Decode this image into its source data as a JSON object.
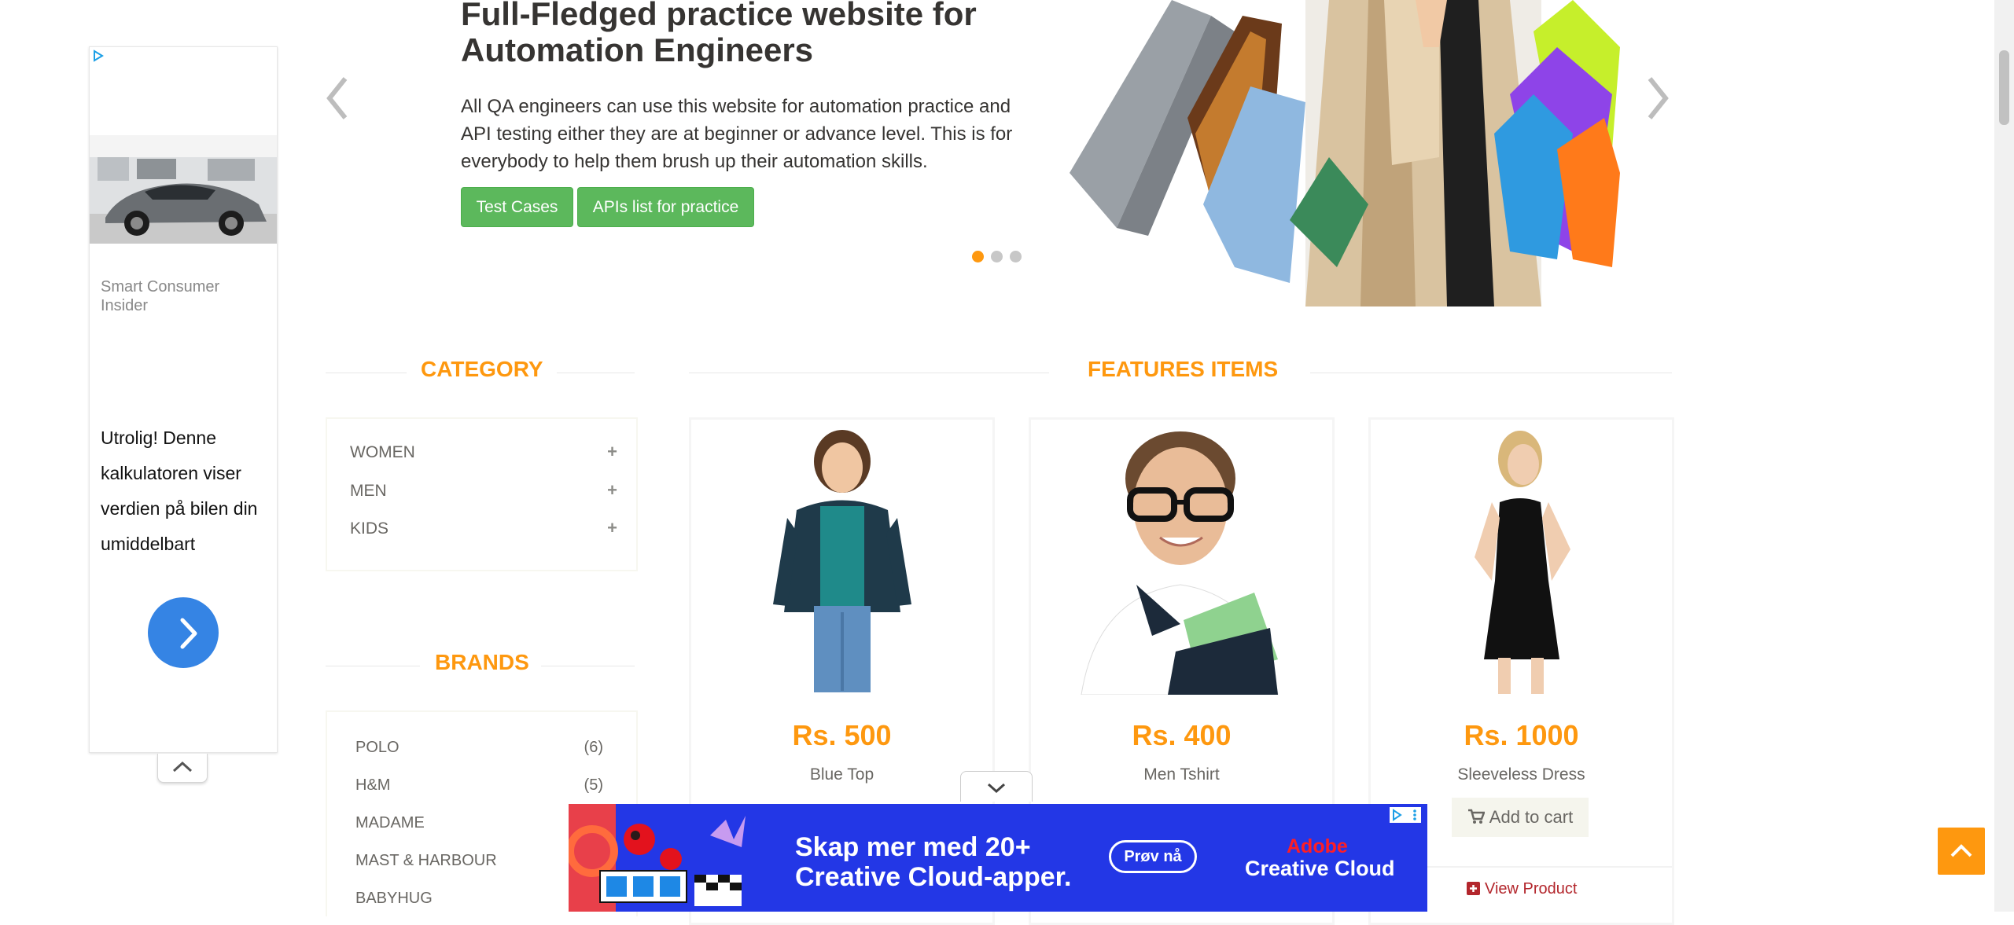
{
  "side_ad": {
    "advertiser": "Smart Consumer Insider",
    "headline": "Utrolig! Denne kalkulatoren viser verdien på bilen din umiddelbart",
    "icons": [
      "adchoices-icon",
      "car-image",
      "chevron-right-icon",
      "chevron-up-icon"
    ]
  },
  "slider": {
    "title": "Full-Fledged practice website for Automation Engineers",
    "text": "All QA engineers can use this website for automation practice and API testing either they are at beginner or advance level. This is for everybody to help them brush up their automation skills.",
    "btn_test_cases": "Test Cases",
    "btn_apis": "APIs list for practice",
    "active_dot": 1,
    "dot_count": 3
  },
  "category": {
    "title": "CATEGORY",
    "items": [
      {
        "label": "WOMEN"
      },
      {
        "label": "MEN"
      },
      {
        "label": "KIDS"
      }
    ]
  },
  "brands": {
    "title": "BRANDS",
    "items": [
      {
        "label": "POLO",
        "count": "(6)"
      },
      {
        "label": "H&M",
        "count": "(5)"
      },
      {
        "label": "MADAME",
        "count": ""
      },
      {
        "label": "MAST & HARBOUR",
        "count": ""
      },
      {
        "label": "BABYHUG",
        "count": ""
      }
    ]
  },
  "features": {
    "title": "FEATURES ITEMS",
    "products": [
      {
        "price": "Rs. 500",
        "name": "Blue Top"
      },
      {
        "price": "Rs. 400",
        "name": "Men Tshirt"
      },
      {
        "price": "Rs. 1000",
        "name": "Sleeveless Dress",
        "add_to_cart": "Add to cart",
        "view_product": "View Product"
      }
    ]
  },
  "bottom_ad": {
    "headline_1": "Skap mer med 20+",
    "headline_2": "Creative Cloud-apper.",
    "cta": "Prøv nå",
    "brand_1": "Adobe",
    "brand_2": "Creative Cloud"
  },
  "colors": {
    "accent": "#fe980f",
    "green_button": "#5cb85c",
    "ad_blue": "#2337e6",
    "view_link": "#b3262c"
  }
}
